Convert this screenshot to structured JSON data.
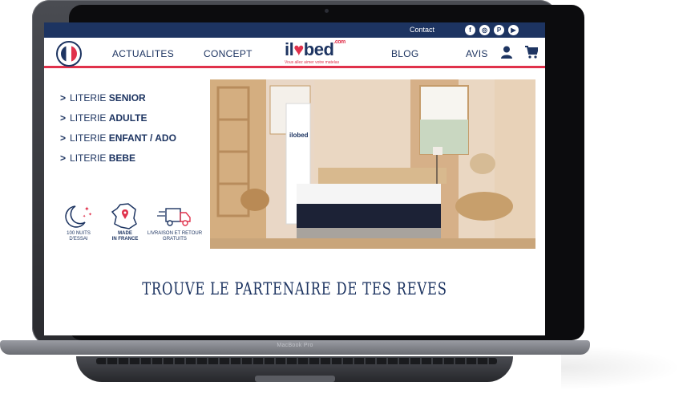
{
  "device": {
    "label": "MacBook Pro"
  },
  "topbar": {
    "contact": "Contact",
    "social": [
      {
        "icon": "facebook-icon",
        "glyph": "f"
      },
      {
        "icon": "instagram-icon",
        "glyph": "◎"
      },
      {
        "icon": "pinterest-icon",
        "glyph": "P"
      },
      {
        "icon": "youtube-icon",
        "glyph": "▶"
      }
    ]
  },
  "nav": {
    "badge": "MADE IN FRANCE",
    "links": [
      "ACTUALITES",
      "CONCEPT",
      "BLOG",
      "AVIS"
    ],
    "logo": {
      "text_before": "il",
      "heart": "♥",
      "text_after": "bed",
      "suffix": ".com",
      "tagline": "Vous allez aimer votre matelas"
    }
  },
  "menu": [
    {
      "prefix": "LITERIE ",
      "bold": "SENIOR"
    },
    {
      "prefix": "LITERIE ",
      "bold": "ADULTE"
    },
    {
      "prefix": "LITERIE ",
      "bold": "ENFANT / ADO"
    },
    {
      "prefix": "LITERIE ",
      "bold": "BEBE"
    }
  ],
  "features": [
    {
      "icon": "moon-stars-icon",
      "label1": "100 NUITS",
      "label2": "D'ESSAI"
    },
    {
      "icon": "france-map-icon",
      "label1": "MADE",
      "label2": "IN FRANCE"
    },
    {
      "icon": "delivery-truck-icon",
      "label1": "LIVRAISON ET RETOUR",
      "label2": "GRATUITS"
    }
  ],
  "hero": {
    "box_label": "ilobed"
  },
  "headline": "TROUVE LE PARTENAIRE DE TES REVES",
  "colors": {
    "navy": "#1d3461",
    "red": "#e0314b"
  }
}
